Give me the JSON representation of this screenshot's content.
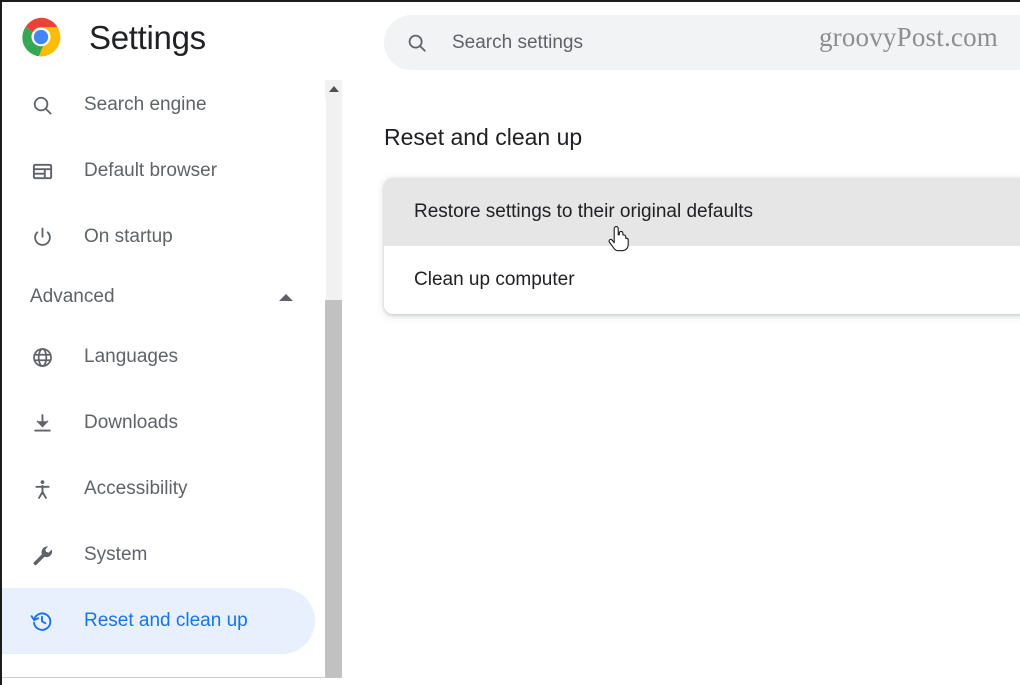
{
  "brand": {
    "logo_icon": "chrome-logo-icon",
    "title": "Settings"
  },
  "sidebar": {
    "items": [
      {
        "icon": "search-icon",
        "label": "Search engine",
        "selected": false
      },
      {
        "icon": "default-browser-icon",
        "label": "Default browser",
        "selected": false
      },
      {
        "icon": "power-icon",
        "label": "On startup",
        "selected": false
      }
    ],
    "section": {
      "label": "Advanced",
      "chevron_icon": "chevron-up-icon",
      "expanded": true
    },
    "advanced_items": [
      {
        "icon": "globe-icon",
        "label": "Languages",
        "selected": false
      },
      {
        "icon": "download-icon",
        "label": "Downloads",
        "selected": false
      },
      {
        "icon": "accessibility-icon",
        "label": "Accessibility",
        "selected": false
      },
      {
        "icon": "wrench-icon",
        "label": "System",
        "selected": false
      },
      {
        "icon": "history-restore-icon",
        "label": "Reset and clean up",
        "selected": true
      }
    ],
    "scrollbar": {
      "up_arrow_icon": "scroll-up-arrow-icon"
    }
  },
  "search": {
    "icon": "search-icon",
    "placeholder": "Search settings",
    "value": ""
  },
  "watermark": {
    "text": "groovyPost.com"
  },
  "main": {
    "page_title": "Reset and clean up",
    "rows": [
      {
        "label": "Restore settings to their original defaults",
        "hovered": true
      },
      {
        "label": "Clean up computer",
        "hovered": false
      }
    ]
  },
  "cursor": {
    "icon": "pointing-hand-cursor-icon"
  },
  "colors": {
    "accent": "#1a73e8",
    "selected_pill": "#e8f0fe",
    "text_primary": "#202124",
    "text_secondary": "#5f6368",
    "search_bg": "#f1f3f4",
    "row_hover": "#e6e6e6"
  }
}
